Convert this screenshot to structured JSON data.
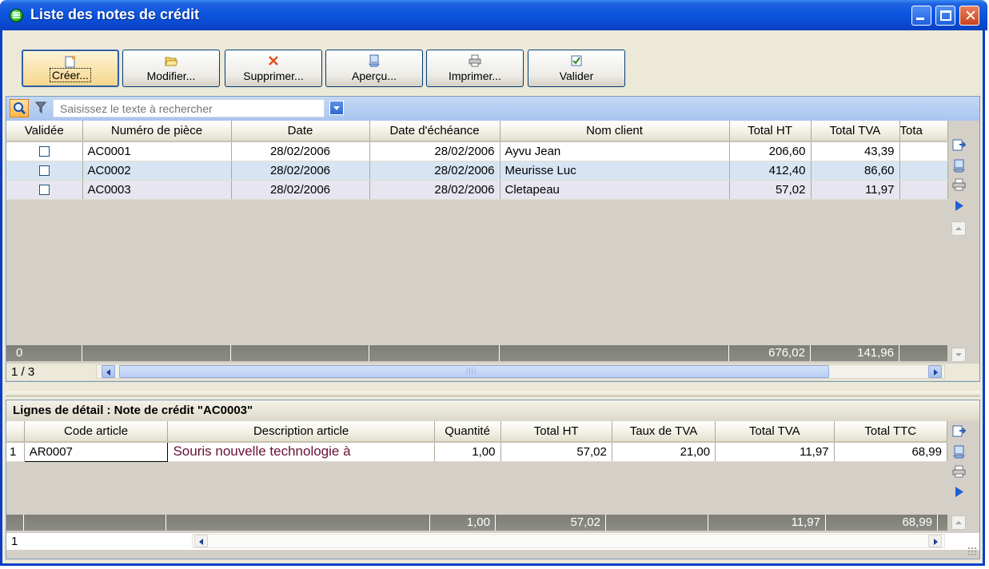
{
  "window": {
    "title": "Liste des notes de crédit"
  },
  "toolbar": [
    {
      "label": "Créer...",
      "icon": "new-document-icon"
    },
    {
      "label": "Modifier...",
      "icon": "open-folder-icon"
    },
    {
      "label": "Supprimer...",
      "icon": "delete-x-icon"
    },
    {
      "label": "Aperçu...",
      "icon": "preview-icon"
    },
    {
      "label": "Imprimer...",
      "icon": "printer-icon"
    },
    {
      "label": "Valider",
      "icon": "validate-icon"
    }
  ],
  "search": {
    "placeholder": "Saisissez le texte à rechercher"
  },
  "main_grid": {
    "columns": [
      "Validée",
      "Numéro de pièce",
      "Date",
      "Date d'échéance",
      "Nom client",
      "Total HT",
      "Total TVA",
      "Tota"
    ],
    "rows": [
      {
        "validated": false,
        "numero": "AC0001",
        "date": "28/02/2006",
        "echeance": "28/02/2006",
        "client": "Ayvu Jean",
        "total_ht": "206,60",
        "total_tva": "43,39"
      },
      {
        "validated": false,
        "numero": "AC0002",
        "date": "28/02/2006",
        "echeance": "28/02/2006",
        "client": "Meurisse Luc",
        "total_ht": "412,40",
        "total_tva": "86,60"
      },
      {
        "validated": false,
        "numero": "AC0003",
        "date": "28/02/2006",
        "echeance": "28/02/2006",
        "client": "Cletapeau",
        "total_ht": "57,02",
        "total_tva": "11,97"
      }
    ],
    "totals": {
      "validated": "0",
      "total_ht": "676,02",
      "total_tva": "141,96"
    },
    "record_position": "1 / 3"
  },
  "detail": {
    "title": "Lignes de détail : Note de crédit \"AC0003\"",
    "columns": [
      "Code article",
      "Description article",
      "Quantité",
      "Total HT",
      "Taux de TVA",
      "Total TVA",
      "Total TTC"
    ],
    "rows": [
      {
        "index": "1",
        "code": "AR0007",
        "description": "Souris nouvelle technologie à",
        "quantite": "1,00",
        "total_ht": "57,02",
        "taux_tva": "21,00",
        "total_tva": "11,97",
        "total_ttc": "68,99"
      }
    ],
    "totals": {
      "quantite": "1,00",
      "total_ht": "57,02",
      "total_tva": "11,97",
      "total_ttc": "68,99"
    },
    "record_position": "1"
  }
}
